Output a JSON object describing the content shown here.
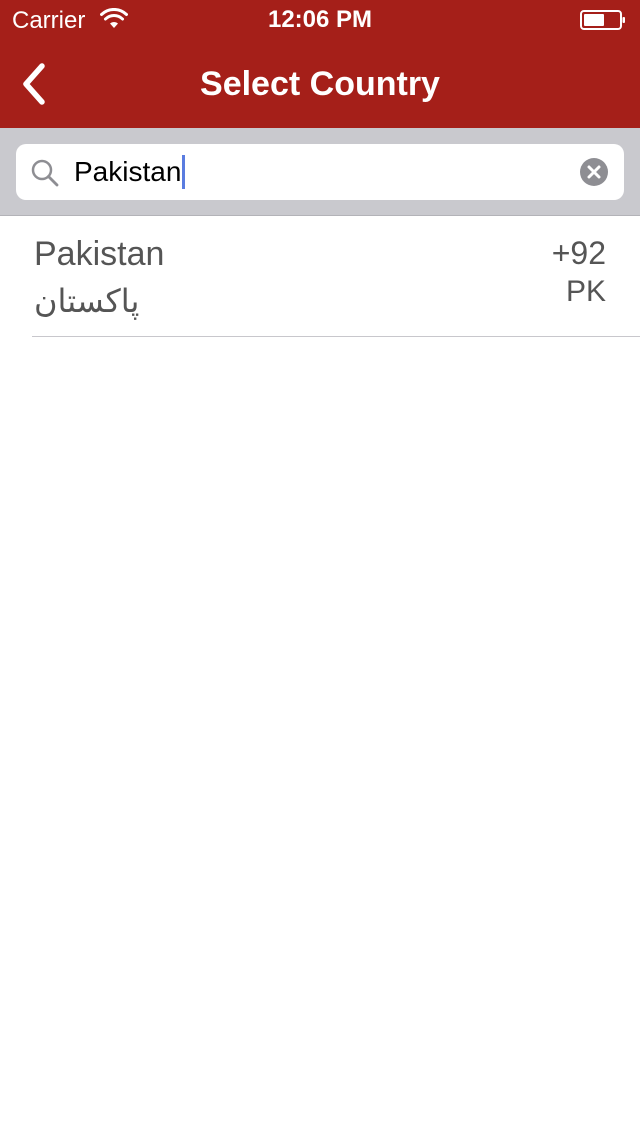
{
  "status_bar": {
    "carrier": "Carrier",
    "time": "12:06 PM",
    "wifi_icon": "wifi-icon",
    "battery_icon": "battery-icon"
  },
  "nav": {
    "back_icon": "chevron-left-icon",
    "title": "Select Country"
  },
  "search": {
    "icon": "search-icon",
    "value": "Pakistan",
    "clear_icon": "clear-circle-icon"
  },
  "results": [
    {
      "name": "Pakistan",
      "native_name": "پاکستان",
      "dial_code": "+92",
      "iso_code": "PK"
    }
  ],
  "colors": {
    "nav_background": "#a51f19",
    "search_area_background": "#c9c9ce",
    "text_primary": "#555555",
    "cursor": "#5a7ce0"
  }
}
